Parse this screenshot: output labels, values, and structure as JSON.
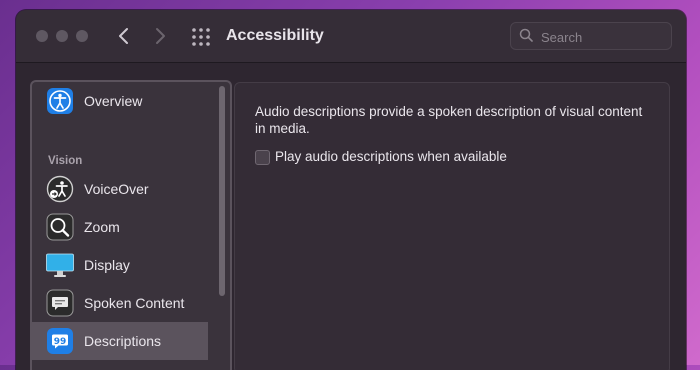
{
  "window": {
    "title": "Accessibility",
    "search": {
      "placeholder": "Search",
      "value": ""
    }
  },
  "sidebar": {
    "section_vision": "Vision",
    "items": [
      {
        "label": "Overview",
        "icon": "accessibility-icon"
      },
      {
        "label": "VoiceOver",
        "icon": "voiceover-icon"
      },
      {
        "label": "Zoom",
        "icon": "zoom-icon"
      },
      {
        "label": "Display",
        "icon": "display-icon"
      },
      {
        "label": "Spoken Content",
        "icon": "spoken-content-icon"
      },
      {
        "label": "Descriptions",
        "icon": "descriptions-icon"
      }
    ],
    "selected": "Descriptions"
  },
  "content": {
    "description": "Audio descriptions provide a spoken description of visual content in media.",
    "checkbox_label": "Play audio descriptions when available",
    "checkbox_checked": false
  },
  "colors": {
    "accent": "#1f7fe6",
    "window_bg": "#2e2630",
    "wallpaper": "#8a3fae"
  }
}
